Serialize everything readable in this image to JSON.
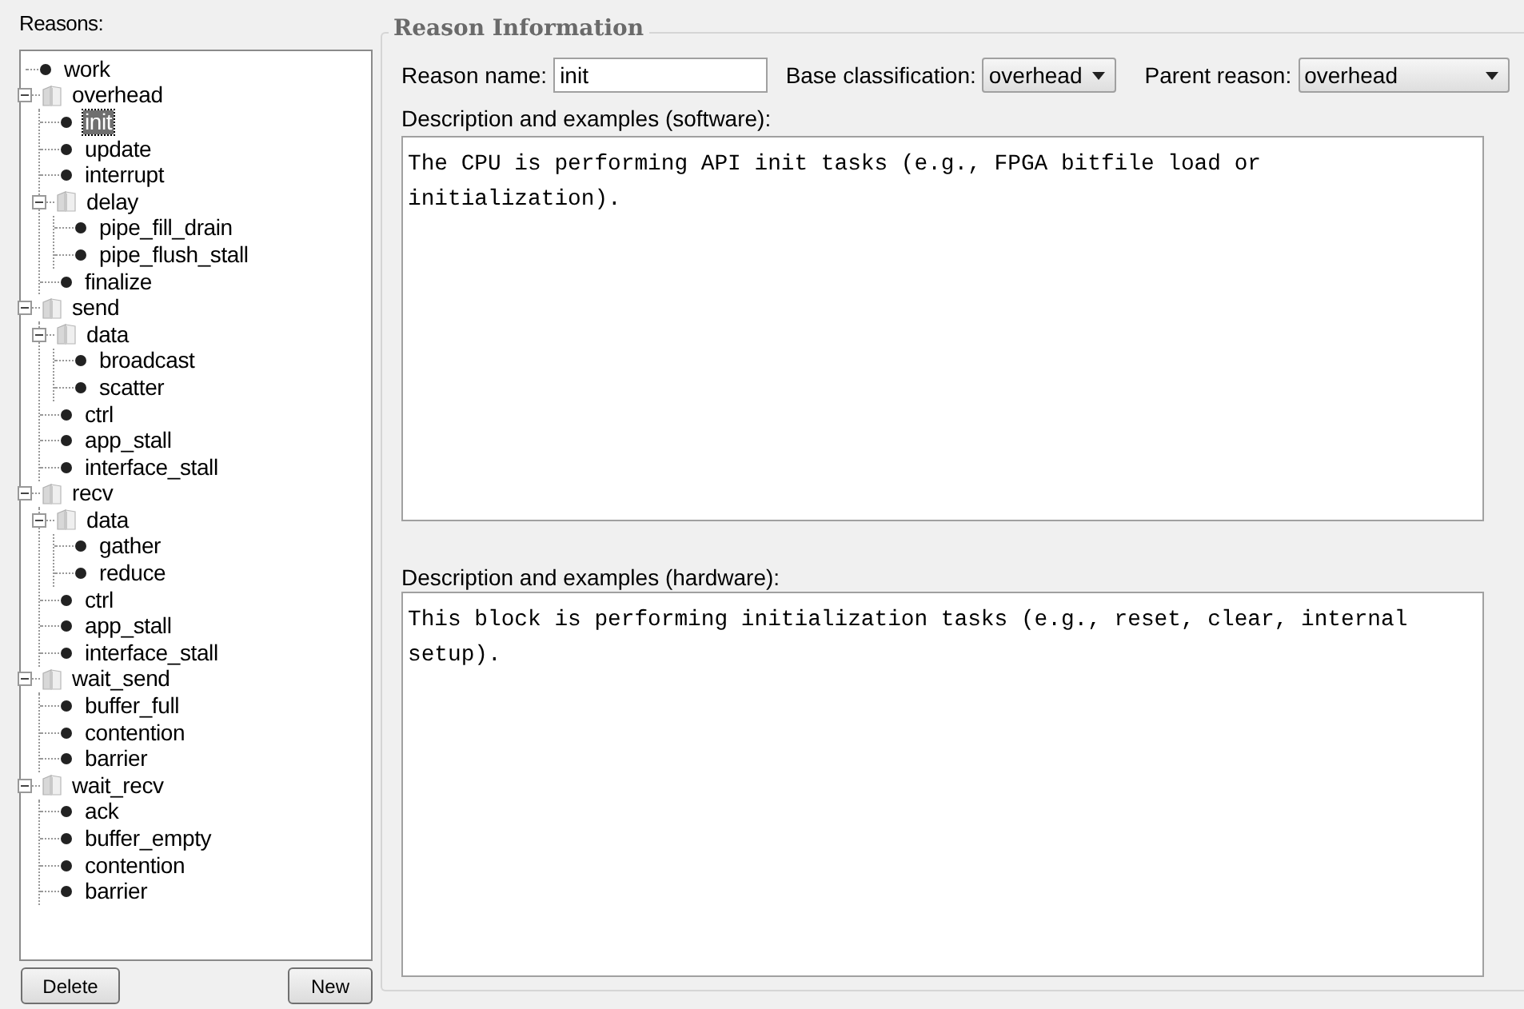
{
  "reasons_panel": {
    "label": "Reasons:",
    "tree": [
      {
        "label": "work",
        "kind": "leaf",
        "selected": false
      },
      {
        "label": "overhead",
        "kind": "folder",
        "expanded": true,
        "selected": false,
        "children": [
          {
            "label": "init",
            "kind": "leaf",
            "selected": true
          },
          {
            "label": "update",
            "kind": "leaf",
            "selected": false
          },
          {
            "label": "interrupt",
            "kind": "leaf",
            "selected": false
          },
          {
            "label": "delay",
            "kind": "folder",
            "expanded": true,
            "selected": false,
            "children": [
              {
                "label": "pipe_fill_drain",
                "kind": "leaf",
                "selected": false
              },
              {
                "label": "pipe_flush_stall",
                "kind": "leaf",
                "selected": false
              }
            ]
          },
          {
            "label": "finalize",
            "kind": "leaf",
            "selected": false
          }
        ]
      },
      {
        "label": "send",
        "kind": "folder",
        "expanded": true,
        "selected": false,
        "children": [
          {
            "label": "data",
            "kind": "folder",
            "expanded": true,
            "selected": false,
            "children": [
              {
                "label": "broadcast",
                "kind": "leaf",
                "selected": false
              },
              {
                "label": "scatter",
                "kind": "leaf",
                "selected": false
              }
            ]
          },
          {
            "label": "ctrl",
            "kind": "leaf",
            "selected": false
          },
          {
            "label": "app_stall",
            "kind": "leaf",
            "selected": false
          },
          {
            "label": "interface_stall",
            "kind": "leaf",
            "selected": false
          }
        ]
      },
      {
        "label": "recv",
        "kind": "folder",
        "expanded": true,
        "selected": false,
        "children": [
          {
            "label": "data",
            "kind": "folder",
            "expanded": true,
            "selected": false,
            "children": [
              {
                "label": "gather",
                "kind": "leaf",
                "selected": false
              },
              {
                "label": "reduce",
                "kind": "leaf",
                "selected": false
              }
            ]
          },
          {
            "label": "ctrl",
            "kind": "leaf",
            "selected": false
          },
          {
            "label": "app_stall",
            "kind": "leaf",
            "selected": false
          },
          {
            "label": "interface_stall",
            "kind": "leaf",
            "selected": false
          }
        ]
      },
      {
        "label": "wait_send",
        "kind": "folder",
        "expanded": true,
        "selected": false,
        "children": [
          {
            "label": "buffer_full",
            "kind": "leaf",
            "selected": false
          },
          {
            "label": "contention",
            "kind": "leaf",
            "selected": false
          },
          {
            "label": "barrier",
            "kind": "leaf",
            "selected": false
          }
        ]
      },
      {
        "label": "wait_recv",
        "kind": "folder",
        "expanded": true,
        "selected": false,
        "children": [
          {
            "label": "ack",
            "kind": "leaf",
            "selected": false
          },
          {
            "label": "buffer_empty",
            "kind": "leaf",
            "selected": false
          },
          {
            "label": "contention",
            "kind": "leaf",
            "selected": false
          },
          {
            "label": "barrier",
            "kind": "leaf",
            "selected": false
          }
        ]
      }
    ],
    "buttons": [
      "Delete",
      "New"
    ]
  },
  "reason_information": {
    "title": "Reason Information",
    "reason_name": {
      "label": "Reason name:",
      "value": "init"
    },
    "base_classification": {
      "label": "Base classification:",
      "value": "overhead"
    },
    "parent_reason": {
      "label": "Parent reason:",
      "value": "overhead"
    },
    "software_description": {
      "label": "Description and examples (software):",
      "value": "The CPU is performing API init tasks (e.g., FPGA bitfile load or initialization)."
    },
    "hardware_description": {
      "label": "Description and examples (hardware):",
      "value": "This block is performing initialization tasks (e.g., reset, clear, internal setup)."
    }
  }
}
